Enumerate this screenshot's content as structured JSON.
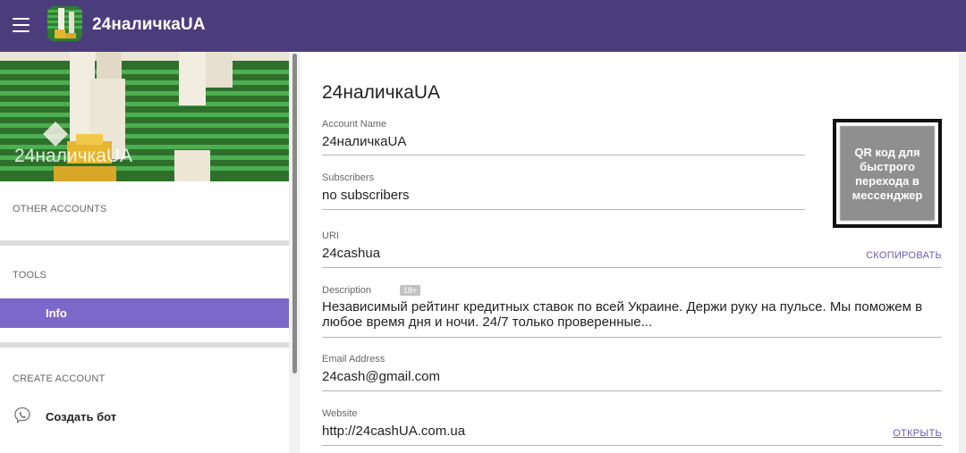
{
  "app": {
    "title": "24наличкаUA"
  },
  "sidebar": {
    "cover_name": "24наличкаUA",
    "other_accounts_heading": "OTHER ACCOUNTS",
    "tools_heading": "TOOLS",
    "tools_items": [
      {
        "label": "Info",
        "active": true
      }
    ],
    "create_account_heading": "CREATE ACCOUNT",
    "create_items": [
      {
        "label": "Создать бот",
        "icon": "viber-icon"
      }
    ]
  },
  "main": {
    "title": "24наличкаUA",
    "fields": {
      "account_name": {
        "label": "Account Name",
        "value": "24наличкаUA"
      },
      "subscribers": {
        "label": "Subscribers",
        "value": "no subscribers"
      },
      "uri": {
        "label": "URI",
        "value": "24cashua",
        "action": "СКОПИРОВАТЬ"
      },
      "description": {
        "label": "Description",
        "badge": "18+",
        "value": "Независимый рейтинг кредитных ставок по всей Украине. Держи руку на пульсе. Мы поможем в любое время дня и ночи. 24/7 только проверенные..."
      },
      "email": {
        "label": "Email Address",
        "value": "24cash@gmail.com"
      },
      "website": {
        "label": "Website",
        "value": "http://24cashUA.com.ua",
        "action": "ОТКРЫТЬ"
      }
    },
    "qr": {
      "text": "QR код для быстрого перехода в мессенджер"
    }
  },
  "colors": {
    "topbar": "#4b3d7c",
    "accent": "#7b68c8",
    "link": "#6b5bbb"
  }
}
